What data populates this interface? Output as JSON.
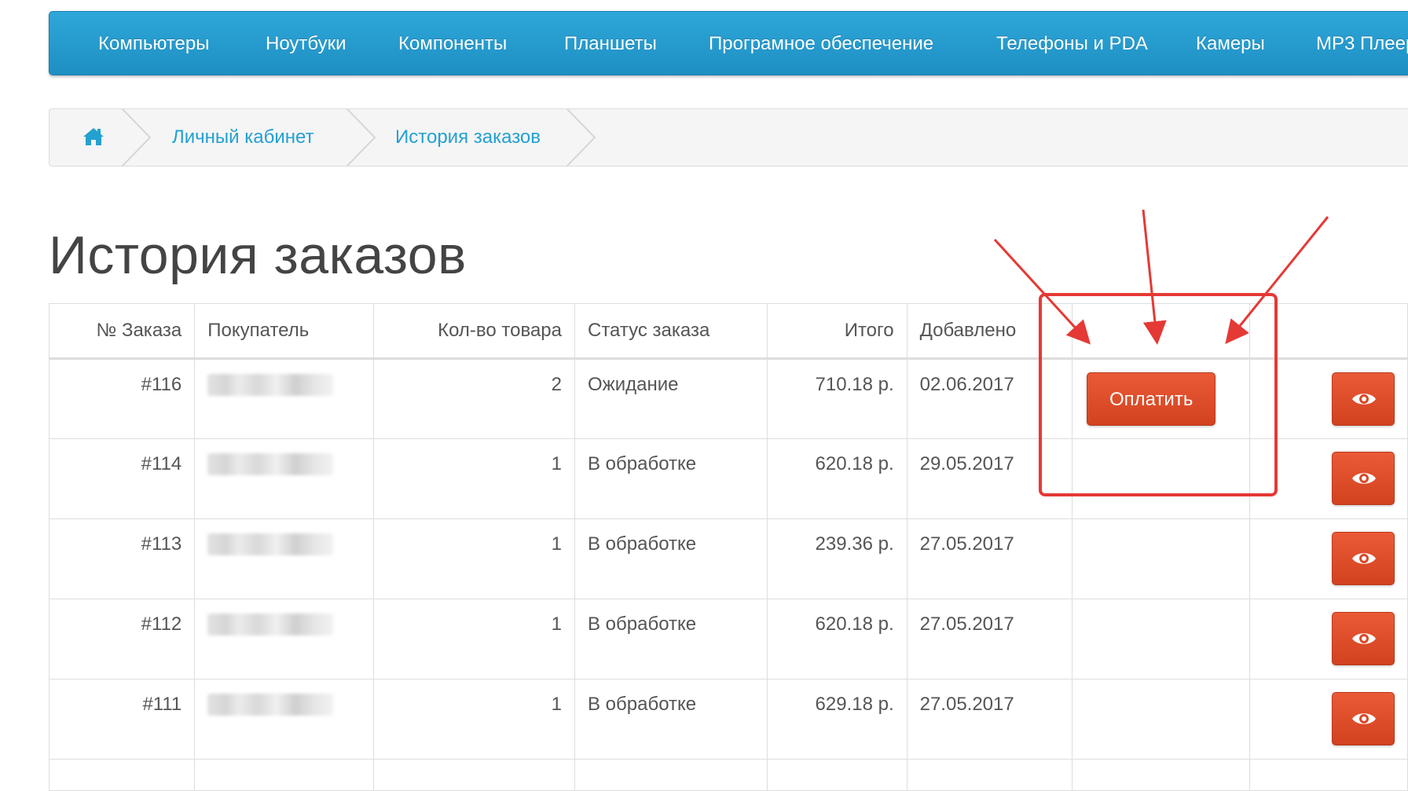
{
  "nav": {
    "items": [
      "Компьютеры",
      "Ноутбуки",
      "Компоненты",
      "Планшеты",
      "Програмное обеспечение",
      "Телефоны и PDA",
      "Камеры",
      "MP3 Плеер"
    ]
  },
  "breadcrumb": {
    "home_icon": "home-icon",
    "items": [
      "Личный кабинет",
      "История заказов"
    ]
  },
  "page": {
    "title": "История заказов"
  },
  "table": {
    "headers": [
      "№ Заказа",
      "Покупатель",
      "Кол-во товара",
      "Статус заказа",
      "Итого",
      "Добавлено",
      "",
      ""
    ],
    "rows": [
      {
        "id": "#116",
        "customer": "",
        "qty": "2",
        "status": "Ожидание",
        "total": "710.18 р.",
        "date": "02.06.2017",
        "pay": "Оплатить"
      },
      {
        "id": "#114",
        "customer": "",
        "qty": "1",
        "status": "В обработке",
        "total": "620.18 р.",
        "date": "29.05.2017"
      },
      {
        "id": "#113",
        "customer": "",
        "qty": "1",
        "status": "В обработке",
        "total": "239.36 р.",
        "date": "27.05.2017"
      },
      {
        "id": "#112",
        "customer": "",
        "qty": "1",
        "status": "В обработке",
        "total": "620.18 р.",
        "date": "27.05.2017"
      },
      {
        "id": "#111",
        "customer": "",
        "qty": "1",
        "status": "В обработке",
        "total": "629.18 р.",
        "date": "27.05.2017"
      }
    ],
    "view_icon": "eye-icon"
  },
  "colors": {
    "nav_bg": "#2ea7d9",
    "link": "#23a1d1",
    "button": "#e0502d",
    "annotation": "#e53935"
  }
}
